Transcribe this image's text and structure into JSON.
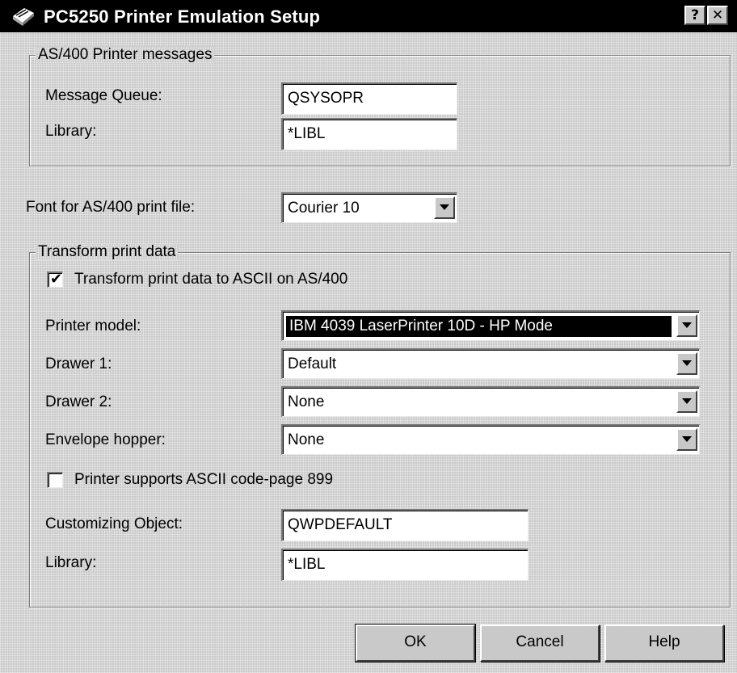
{
  "window": {
    "title": "PC5250 Printer Emulation Setup",
    "help_glyph": "?",
    "close_glyph": "✕"
  },
  "printer_messages": {
    "legend": "AS/400 Printer messages",
    "message_queue_label": "Message Queue:",
    "message_queue_value": "QSYSOPR",
    "library_label": "Library:",
    "library_value": "*LIBL"
  },
  "font": {
    "label": "Font for AS/400 print file:",
    "selected": "Courier 10"
  },
  "transform": {
    "legend": "Transform print data",
    "checkbox_label": "Transform print data to ASCII on AS/400",
    "checkbox_checked": true,
    "check_glyph": "✔",
    "printer_model_label": "Printer model:",
    "printer_model_value": "IBM 4039 LaserPrinter 10D - HP Mode",
    "drawer1_label": "Drawer 1:",
    "drawer1_value": "Default",
    "drawer2_label": "Drawer 2:",
    "drawer2_value": "None",
    "envelope_label": "Envelope hopper:",
    "envelope_value": "None",
    "codepage_label": "Printer supports ASCII code-page 899",
    "codepage_checked": false,
    "customizing_label": "Customizing Object:",
    "customizing_value": "QWPDEFAULT",
    "library_label": "Library:",
    "library_value": "*LIBL"
  },
  "buttons": {
    "ok": "OK",
    "cancel": "Cancel",
    "help": "Help"
  },
  "colors": {
    "titlebar": "#000000",
    "dialog_face": "#c9c9c9",
    "selection": "#000000"
  }
}
